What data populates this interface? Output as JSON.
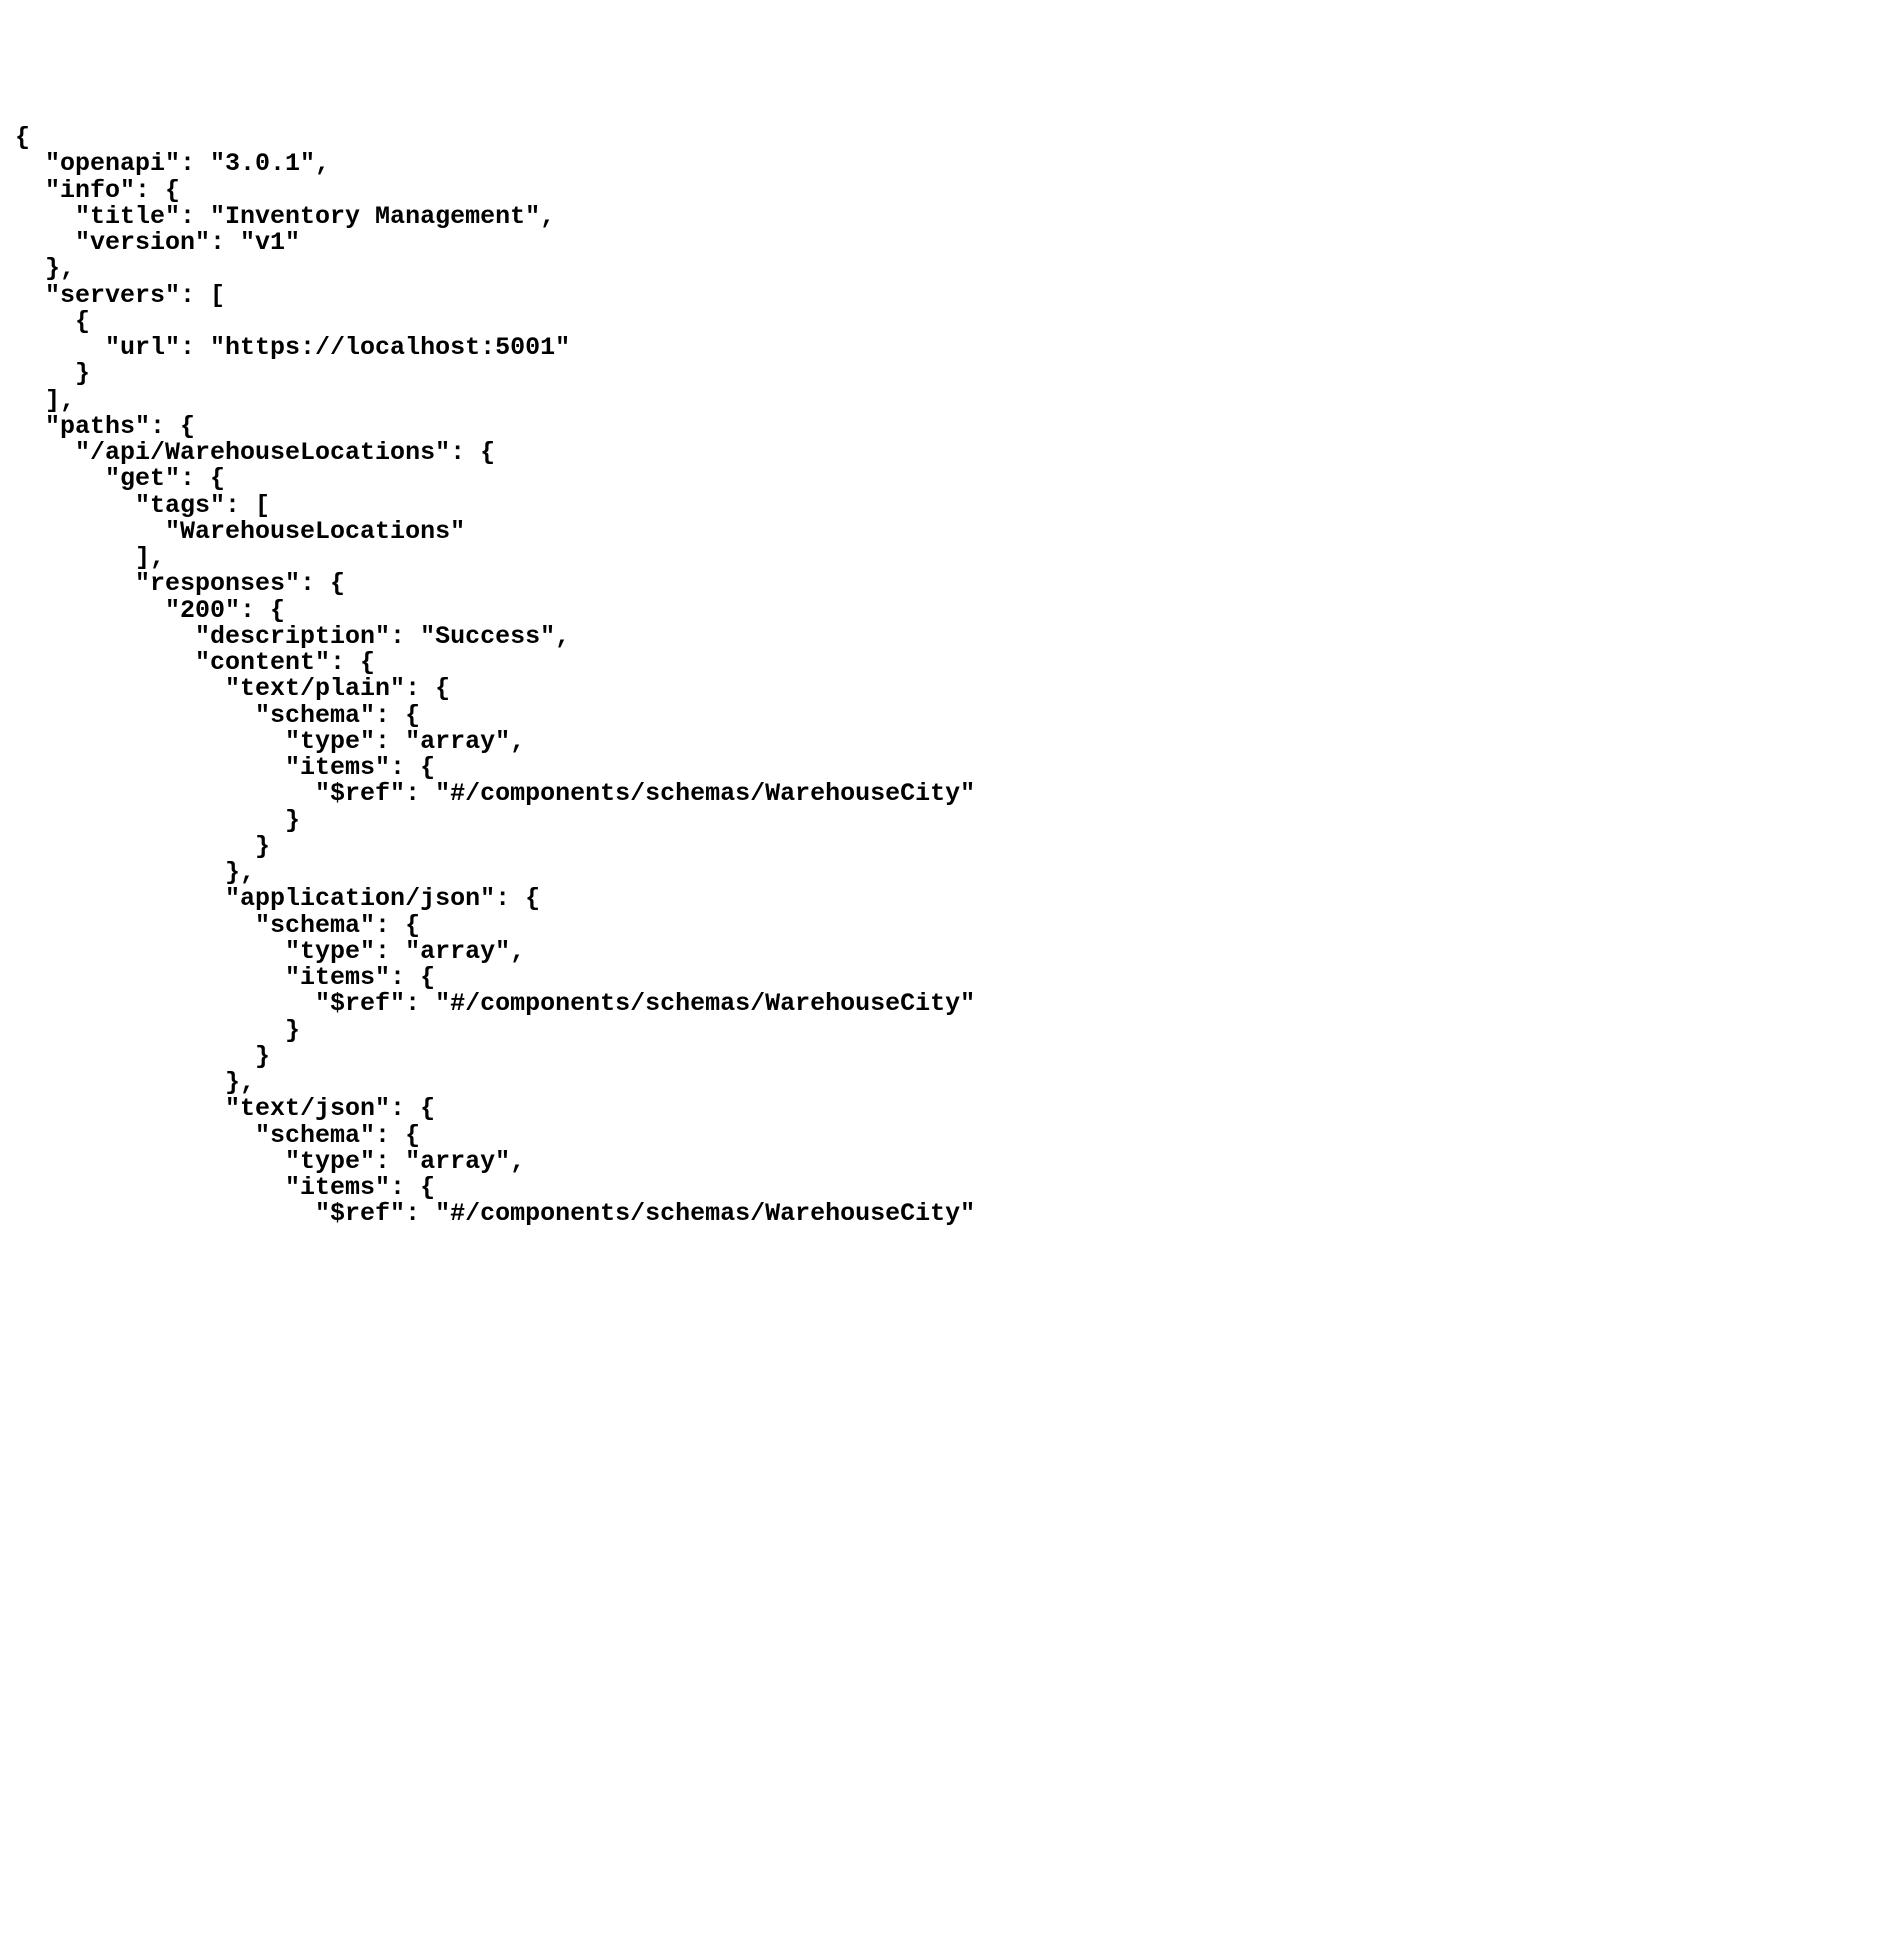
{
  "lines": [
    "{",
    "  \"openapi\": \"3.0.1\",",
    "  \"info\": {",
    "    \"title\": \"Inventory Management\",",
    "    \"version\": \"v1\"",
    "  },",
    "  \"servers\": [",
    "    {",
    "      \"url\": \"https://localhost:5001\"",
    "    }",
    "  ],",
    "  \"paths\": {",
    "    \"/api/WarehouseLocations\": {",
    "      \"get\": {",
    "        \"tags\": [",
    "          \"WarehouseLocations\"",
    "        ],",
    "        \"responses\": {",
    "          \"200\": {",
    "            \"description\": \"Success\",",
    "            \"content\": {",
    "              \"text/plain\": {",
    "                \"schema\": {",
    "                  \"type\": \"array\",",
    "                  \"items\": {",
    "                    \"$ref\": \"#/components/schemas/WarehouseCity\"",
    "                  }",
    "                }",
    "              },",
    "              \"application/json\": {",
    "                \"schema\": {",
    "                  \"type\": \"array\",",
    "                  \"items\": {",
    "                    \"$ref\": \"#/components/schemas/WarehouseCity\"",
    "                  }",
    "                }",
    "              },",
    "              \"text/json\": {",
    "                \"schema\": {",
    "                  \"type\": \"array\",",
    "                  \"items\": {",
    "                    \"$ref\": \"#/components/schemas/WarehouseCity\""
  ]
}
